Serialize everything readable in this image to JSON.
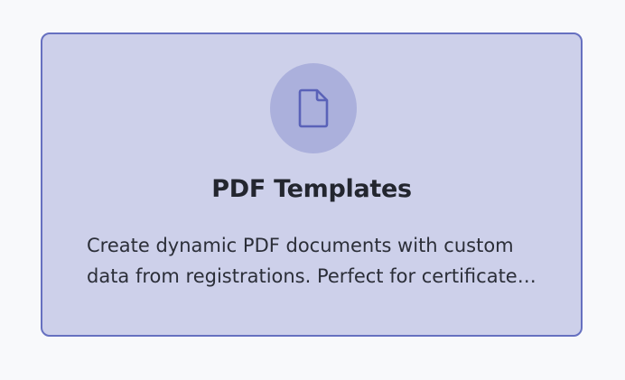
{
  "card": {
    "icon": "document-icon",
    "title": "PDF Templates",
    "description": "Create dynamic PDF documents with custom data from registrations. Perfect for certificates, badges, and confirmations.",
    "colors": {
      "background": "#cdd0ea",
      "border": "#6670c0",
      "icon_circle": "#abb0dc",
      "icon_stroke": "#5a62b8"
    }
  }
}
